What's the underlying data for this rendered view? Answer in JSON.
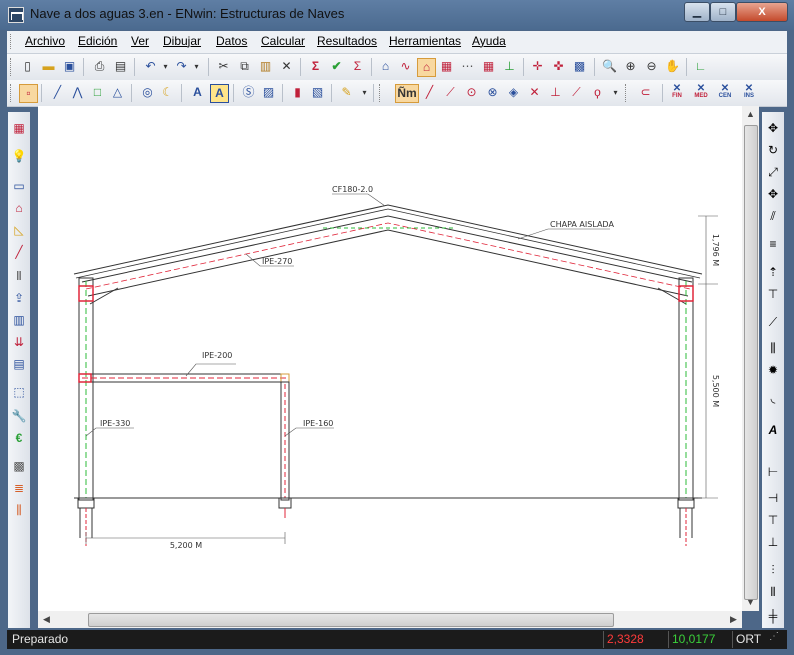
{
  "window": {
    "title": "Nave a dos aguas 3.en - ENwin: Estructuras de Naves",
    "minimize_label": "▁",
    "maximize_label": "□",
    "close_label": "X"
  },
  "menu": [
    {
      "label": "Archivo"
    },
    {
      "label": "Edición"
    },
    {
      "label": "Ver"
    },
    {
      "label": "Dibujar"
    },
    {
      "label": "Datos"
    },
    {
      "label": "Calcular"
    },
    {
      "label": "Resultados"
    },
    {
      "label": "Herramientas"
    },
    {
      "label": "Ayuda"
    }
  ],
  "toolbar2": {
    "snap_labels": [
      "FIN",
      "MED",
      "CEN",
      "INS"
    ],
    "nm_label": "Ñm"
  },
  "drawing": {
    "labels": {
      "purlin": "CF180-2.0",
      "cover": "CHAPA AISLADA",
      "rafter": "IPE-270",
      "beam": "IPE-200",
      "column": "IPE-330",
      "inner_column": "IPE-160",
      "dim_top": "1,796 M",
      "dim_right": "5,500 M",
      "dim_bottom": "5,200 M"
    },
    "colors": {
      "structure": "#333333",
      "axis_red": "#e0263a",
      "axis_green": "#2dbb3a"
    }
  },
  "status": {
    "text": "Preparado",
    "x_value": "2,3328",
    "y_value": "10,0177",
    "mode": "ORT",
    "x_color": "#ff3b3b",
    "y_color": "#3bd13b"
  }
}
